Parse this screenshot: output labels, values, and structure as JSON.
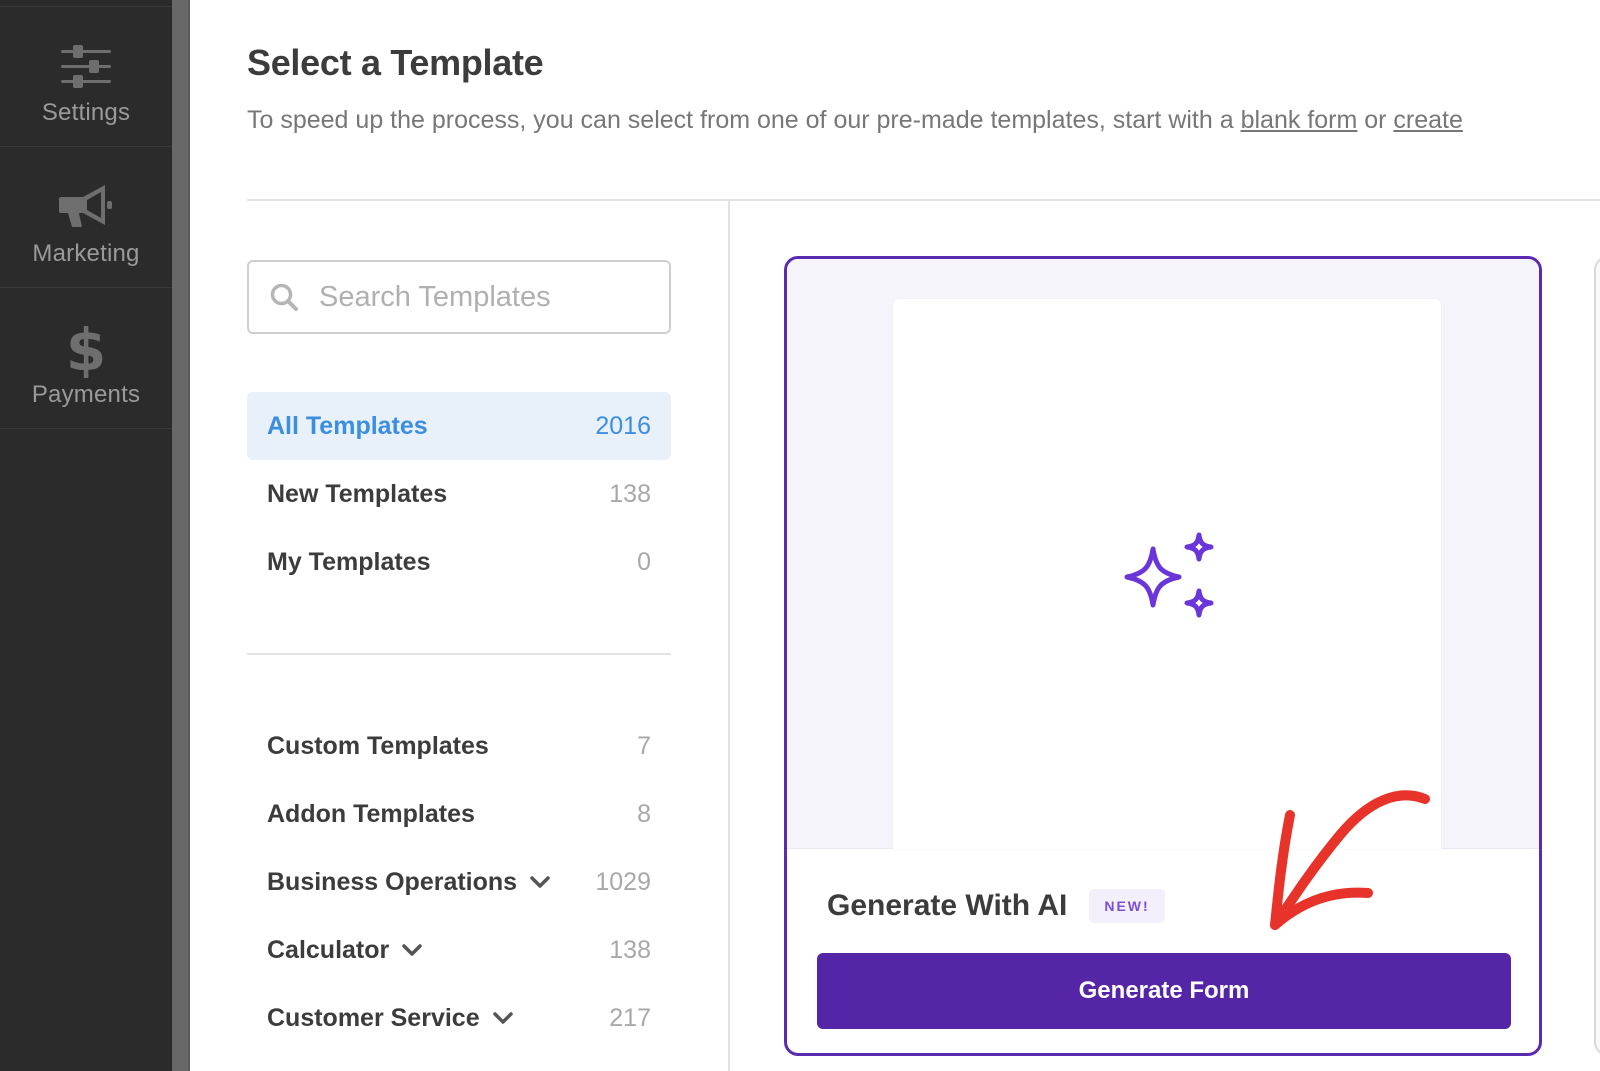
{
  "sidebar": {
    "items": [
      {
        "label": "Settings",
        "icon": "sliders-icon"
      },
      {
        "label": "Marketing",
        "icon": "megaphone-icon"
      },
      {
        "label": "Payments",
        "icon": "dollar-icon"
      }
    ]
  },
  "header": {
    "title": "Select a Template",
    "description_prefix": "To speed up the process, you can select from one of our pre-made templates, start with a ",
    "blank_form_link": "blank form",
    "description_middle": " or ",
    "create_link": "create"
  },
  "search": {
    "placeholder": "Search Templates",
    "value": ""
  },
  "categories": {
    "primary": [
      {
        "label": "All Templates",
        "count": "2016",
        "active": true
      },
      {
        "label": "New Templates",
        "count": "138",
        "active": false
      },
      {
        "label": "My Templates",
        "count": "0",
        "active": false
      }
    ],
    "secondary": [
      {
        "label": "Custom Templates",
        "count": "7",
        "expandable": false
      },
      {
        "label": "Addon Templates",
        "count": "8",
        "expandable": false
      },
      {
        "label": "Business Operations",
        "count": "1029",
        "expandable": true
      },
      {
        "label": "Calculator",
        "count": "138",
        "expandable": true
      },
      {
        "label": "Customer Service",
        "count": "217",
        "expandable": true
      }
    ]
  },
  "template_card": {
    "title": "Generate With AI",
    "badge": "NEW!",
    "button_label": "Generate Form",
    "icon": "sparkles-icon",
    "selected": true
  },
  "colors": {
    "accent_purple": "#5525a8",
    "active_blue": "#3c8ee0",
    "annotation_red": "#e8332a"
  }
}
